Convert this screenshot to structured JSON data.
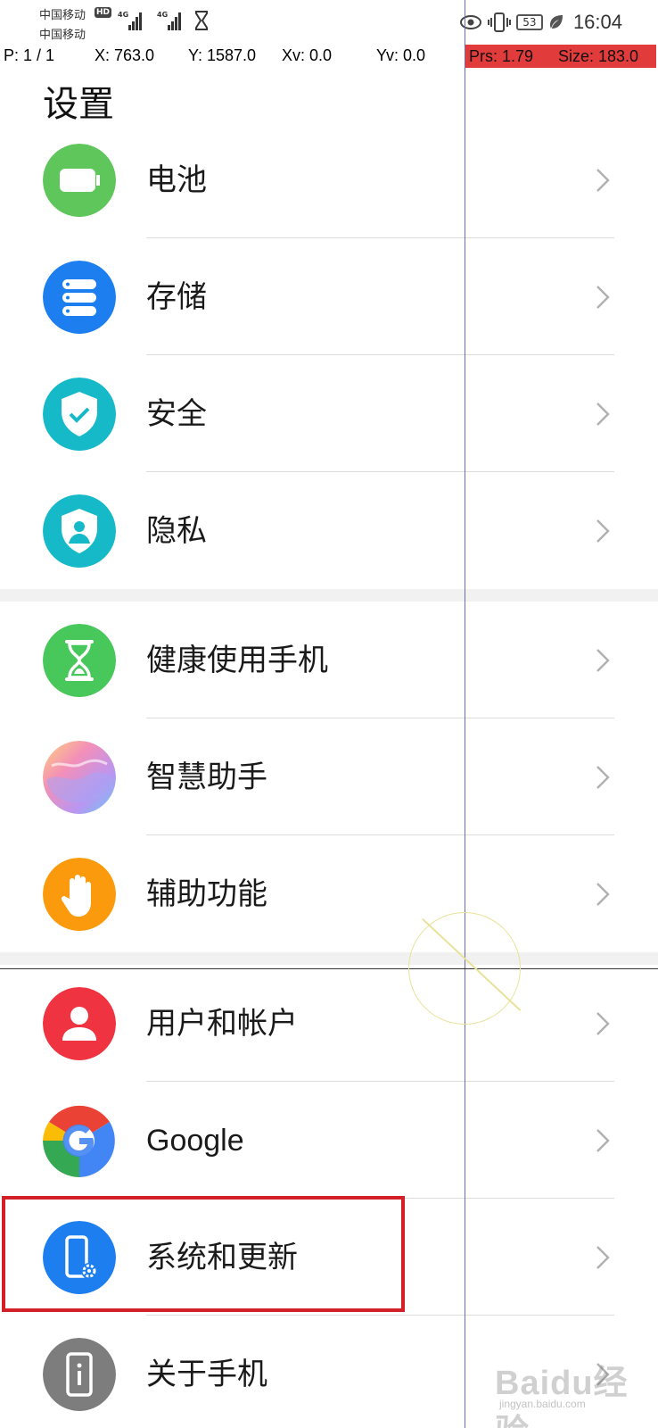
{
  "status": {
    "carrier1": "中国移动",
    "carrier2": "中国移动",
    "hd": "HD",
    "net1": "4G",
    "net2": "4G",
    "battery": "53",
    "time": "16:04"
  },
  "pointer_overlay": {
    "p": "P: 1 / 1",
    "x": "X: 763.0",
    "y": "Y: 1587.0",
    "xv": "Xv: 0.0",
    "yv": "Yv: 0.0",
    "prs": "Prs: 1.79",
    "size": "Size: 183.0"
  },
  "title": "设置",
  "items": [
    {
      "label": "电池",
      "icon": "battery-icon",
      "color": "#5ec65a"
    },
    {
      "label": "存储",
      "icon": "storage-icon",
      "color": "#1d7ef0"
    },
    {
      "label": "安全",
      "icon": "shield-icon",
      "color": "#16b9c7"
    },
    {
      "label": "隐私",
      "icon": "privacy-icon",
      "color": "#16b9c7"
    },
    {
      "label": "健康使用手机",
      "icon": "hourglass-icon",
      "color": "#48c75a"
    },
    {
      "label": "智慧助手",
      "icon": "assistant-icon",
      "color": "#c49bf0"
    },
    {
      "label": "辅助功能",
      "icon": "hand-icon",
      "color": "#fb9a0d"
    },
    {
      "label": "用户和帐户",
      "icon": "user-icon",
      "color": "#ef3340"
    },
    {
      "label": "Google",
      "icon": "google-icon",
      "color": "#4285f4"
    },
    {
      "label": "系统和更新",
      "icon": "phone-settings-icon",
      "color": "#1d7ef0"
    },
    {
      "label": "关于手机",
      "icon": "info-phone-icon",
      "color": "#7d7d7d"
    }
  ],
  "watermark": {
    "main": "Baidu经验",
    "sub": "jingyan.baidu.com"
  }
}
